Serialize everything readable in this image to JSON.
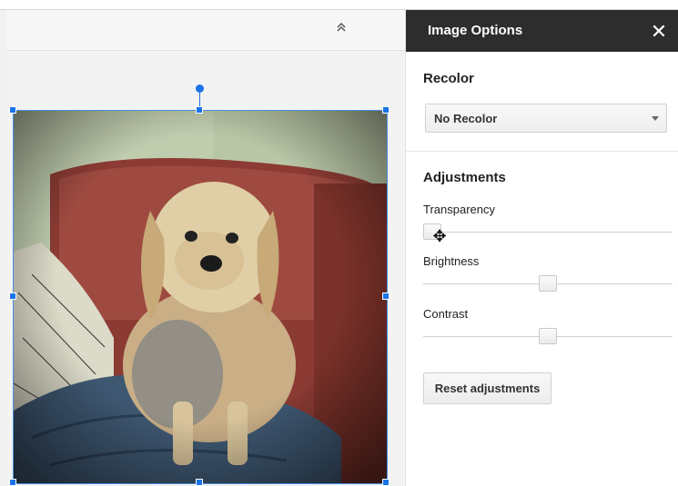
{
  "toolbar": {
    "collapse_icon": "double-chevron-up-icon",
    "collapse_glyph": "⌃"
  },
  "image": {
    "alt": "Dog sitting on red sofa"
  },
  "panel": {
    "title": "Image Options",
    "close_icon": "close-icon",
    "close_glyph": "✕",
    "recolor": {
      "heading": "Recolor",
      "selected": "No Recolor",
      "caret_icon": "caret-down-icon"
    },
    "adjustments": {
      "heading": "Adjustments",
      "sliders": [
        {
          "label": "Transparency",
          "level": 0
        },
        {
          "label": "Brightness",
          "level": 0.5
        },
        {
          "label": "Contrast",
          "level": 0.5
        }
      ],
      "reset_label": "Reset adjustments"
    },
    "cursor_icon": "move-cursor-icon",
    "cursor_glyph": "✥"
  },
  "colors": {
    "header_bg": "#2d2d2d",
    "selection_blue": "#1a73e8"
  }
}
